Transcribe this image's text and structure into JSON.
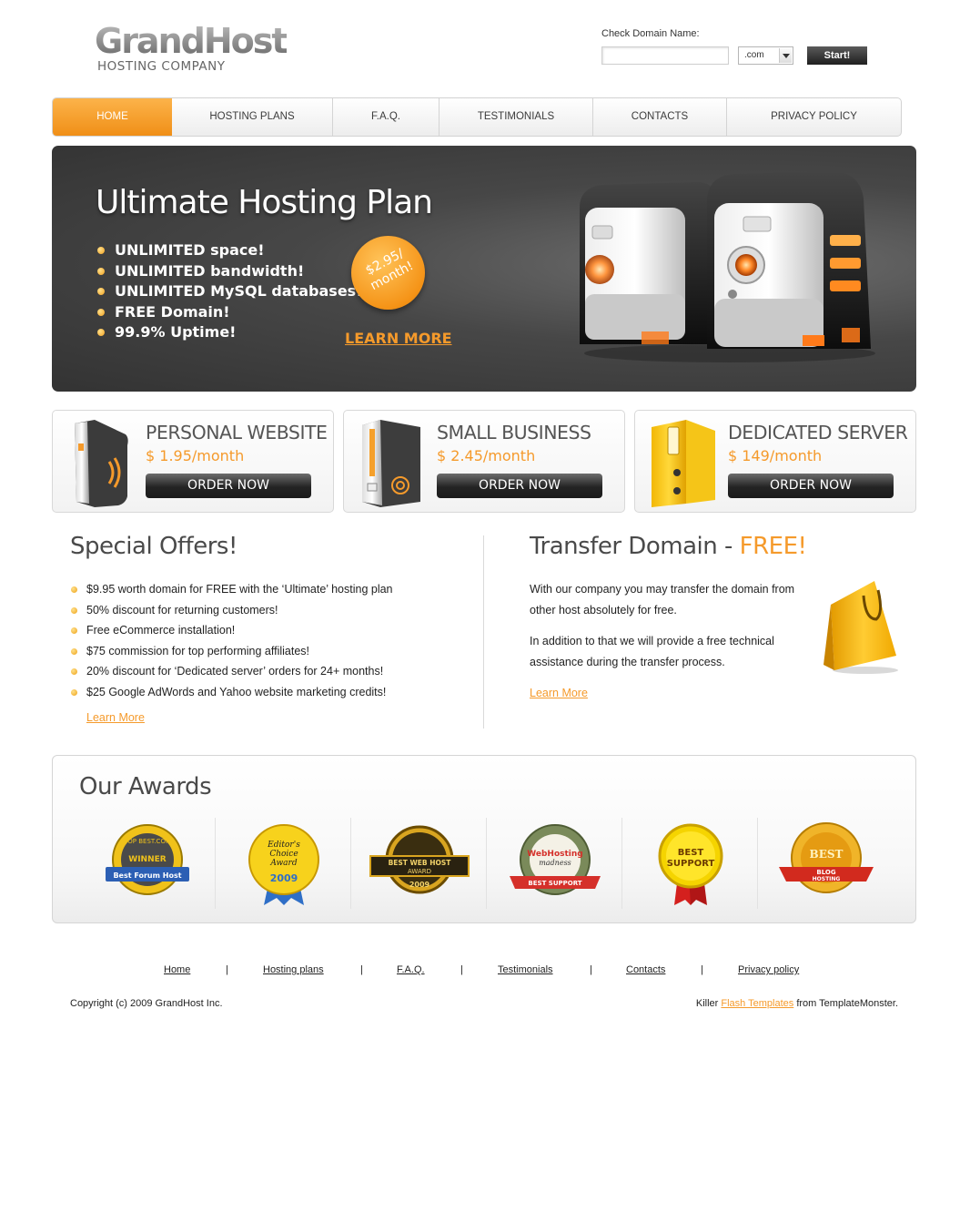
{
  "logo": {
    "name": "GrandHost",
    "tagline": "HOSTING COMPANY"
  },
  "domain_check": {
    "label": "Check Domain Name:",
    "value": "",
    "placeholder": "",
    "tld": ".com",
    "button": "Start!"
  },
  "nav": [
    {
      "label": "HOME",
      "active": true
    },
    {
      "label": "HOSTING PLANS",
      "active": false
    },
    {
      "label": "F.A.Q.",
      "active": false
    },
    {
      "label": "TESTIMONIALS",
      "active": false
    },
    {
      "label": "CONTACTS",
      "active": false
    },
    {
      "label": "PRIVACY POLICY",
      "active": false
    }
  ],
  "banner": {
    "title": "Ultimate Hosting Plan",
    "features": [
      "UNLIMITED space!",
      "UNLIMITED bandwidth!",
      "UNLIMITED MySQL databases!",
      "FREE Domain!",
      "99.9% Uptime!"
    ],
    "price_badge": "$2.95/ month!",
    "learn_more": "LEARN MORE"
  },
  "plans": [
    {
      "title": "PERSONAL WEBSITE",
      "price": "$ 1.95/month",
      "button": "ORDER NOW",
      "icon": "server-tower-icon"
    },
    {
      "title": "SMALL BUSINESS",
      "price": "$ 2.45/month",
      "button": "ORDER NOW",
      "icon": "server-box-icon"
    },
    {
      "title": "DEDICATED SERVER",
      "price": "$ 149/month",
      "button": "ORDER NOW",
      "icon": "binder-folder-icon"
    }
  ],
  "offers": {
    "title": "Special Offers!",
    "items": [
      "$9.95 worth domain for FREE with the ‘Ultimate’ hosting plan",
      "50% discount for returning customers!",
      "Free eCommerce installation!",
      "$75 commission for top performing affiliates!",
      "20% discount for ‘Dedicated server’ orders for 24+ months!",
      "$25 Google AdWords and Yahoo website marketing credits!"
    ],
    "learn_more": "Learn More"
  },
  "transfer": {
    "title": "Transfer Domain - ",
    "title_highlight": "FREE!",
    "p1": "With our company you may transfer the domain from other host absolutely for free.",
    "p2": "In addition to that we will provide a free technical assistance during the transfer process.",
    "learn_more": "Learn More"
  },
  "awards": {
    "title": "Our Awards",
    "badges": [
      {
        "name": "best-forum-host-award",
        "lines": [
          "TOP BEST.COM",
          "WINNER",
          "Best Forum Host"
        ]
      },
      {
        "name": "editors-choice-award",
        "lines": [
          "Editor's",
          "Choice",
          "Award",
          "2009"
        ]
      },
      {
        "name": "best-web-host-award",
        "lines": [
          "BEST WEB HOST",
          "AWARD",
          "2009"
        ]
      },
      {
        "name": "webhosting-madness-award",
        "lines": [
          "WebHosting",
          "madness",
          "BEST SUPPORT"
        ]
      },
      {
        "name": "best-support-award",
        "lines": [
          "BEST",
          "SUPPORT"
        ]
      },
      {
        "name": "best-blog-hosting-award",
        "lines": [
          "BEST",
          "BLOG",
          "HOSTING"
        ]
      }
    ]
  },
  "footer": {
    "links": [
      "Home",
      "Hosting plans",
      "F.A.Q.",
      "Testimonials",
      "Contacts",
      "Privacy policy"
    ],
    "separator": "|",
    "copyright": "Copyright (c) 2009 GrandHost Inc.",
    "credits_prefix": "Killer ",
    "credits_link": "Flash Templates",
    "credits_suffix": " from TemplateMonster."
  },
  "colors": {
    "accent": "#f59a2b",
    "nav_active": "#f39a23",
    "banner_bg": "#454545",
    "dark_button": "#262626"
  }
}
